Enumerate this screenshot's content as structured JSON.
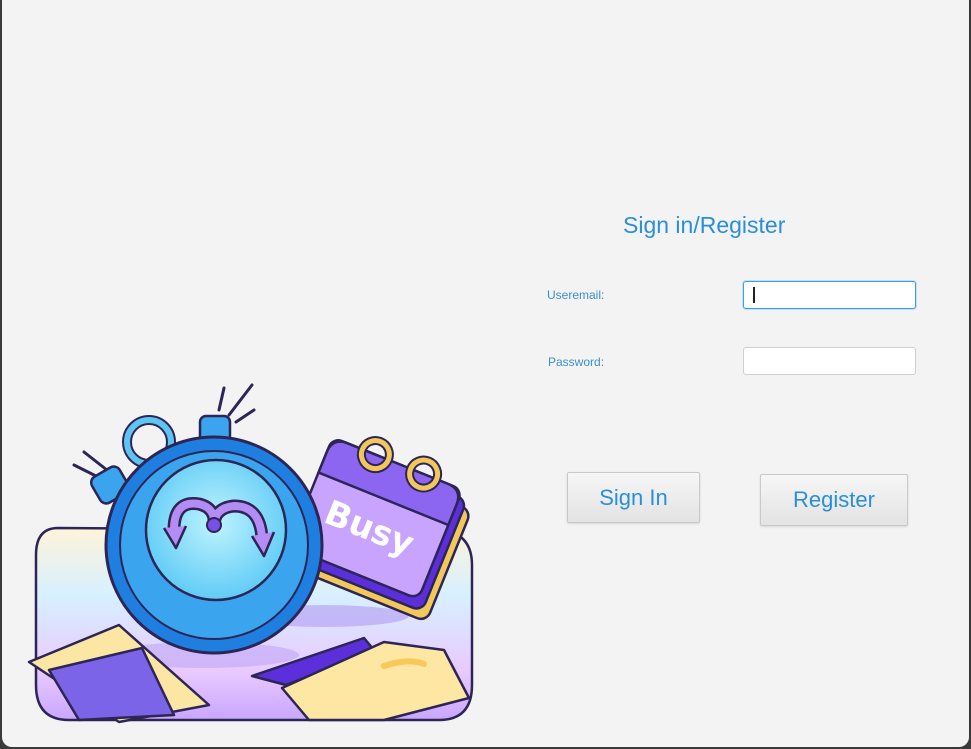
{
  "form": {
    "title": "Sign in/Register",
    "email_label": "Useremail:",
    "password_label": "Password:",
    "email_value": "",
    "password_value": ""
  },
  "buttons": {
    "sign_in": "Sign In",
    "register": "Register"
  },
  "illustration": {
    "badge_text": "Busy",
    "icons": [
      "stopwatch-icon",
      "calendar-icon",
      "folder-icon"
    ]
  }
}
